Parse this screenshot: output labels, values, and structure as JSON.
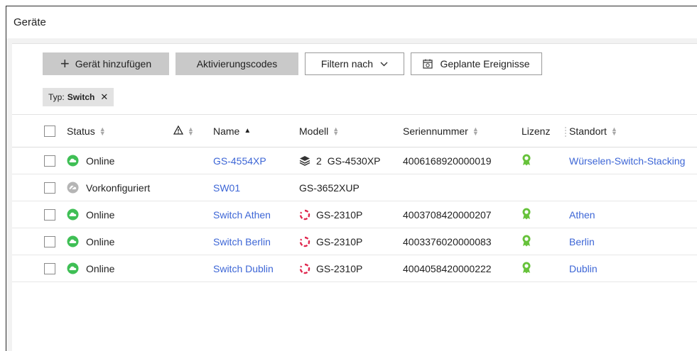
{
  "page": {
    "title": "Geräte"
  },
  "toolbar": {
    "add_device": "Gerät hinzufügen",
    "activation_codes": "Aktivierungscodes",
    "filter_by": "Filtern nach",
    "scheduled_events": "Geplante Ereignisse"
  },
  "filter_chip": {
    "key": "Typ:",
    "value": "Switch",
    "remove": "✕"
  },
  "table": {
    "headers": {
      "status": "Status",
      "name": "Name",
      "model": "Modell",
      "serial": "Seriennummer",
      "license": "Lizenz",
      "location": "Standort"
    },
    "rows": [
      {
        "status": "Online",
        "status_kind": "online",
        "name": "GS-4554XP",
        "model_icon": "stack-icon",
        "stack_count": "2",
        "model": "GS-4530XP",
        "serial": "4006168920000019",
        "license": true,
        "location": "Würselen-Switch-Stacking"
      },
      {
        "status": "Vorkonfiguriert",
        "status_kind": "preconfigured",
        "name": "SW01",
        "model_icon": "",
        "stack_count": "",
        "model": "GS-3652XUP",
        "serial": "",
        "license": false,
        "location": ""
      },
      {
        "status": "Online",
        "status_kind": "online",
        "name": "Switch Athen",
        "model_icon": "switch-icon",
        "stack_count": "",
        "model": "GS-2310P",
        "serial": "4003708420000207",
        "license": true,
        "location": "Athen"
      },
      {
        "status": "Online",
        "status_kind": "online",
        "name": "Switch Berlin",
        "model_icon": "switch-icon",
        "stack_count": "",
        "model": "GS-2310P",
        "serial": "4003376020000083",
        "license": true,
        "location": "Berlin"
      },
      {
        "status": "Online",
        "status_kind": "online",
        "name": "Switch Dublin",
        "model_icon": "switch-icon",
        "stack_count": "",
        "model": "GS-2310P",
        "serial": "4004058420000222",
        "license": true,
        "location": "Dublin"
      }
    ]
  },
  "colors": {
    "online": "#3fbf55",
    "preconfigured": "#b5b5b5",
    "link": "#3d66d6",
    "license": "#66c23a",
    "switch_icon": "#e0284f"
  }
}
